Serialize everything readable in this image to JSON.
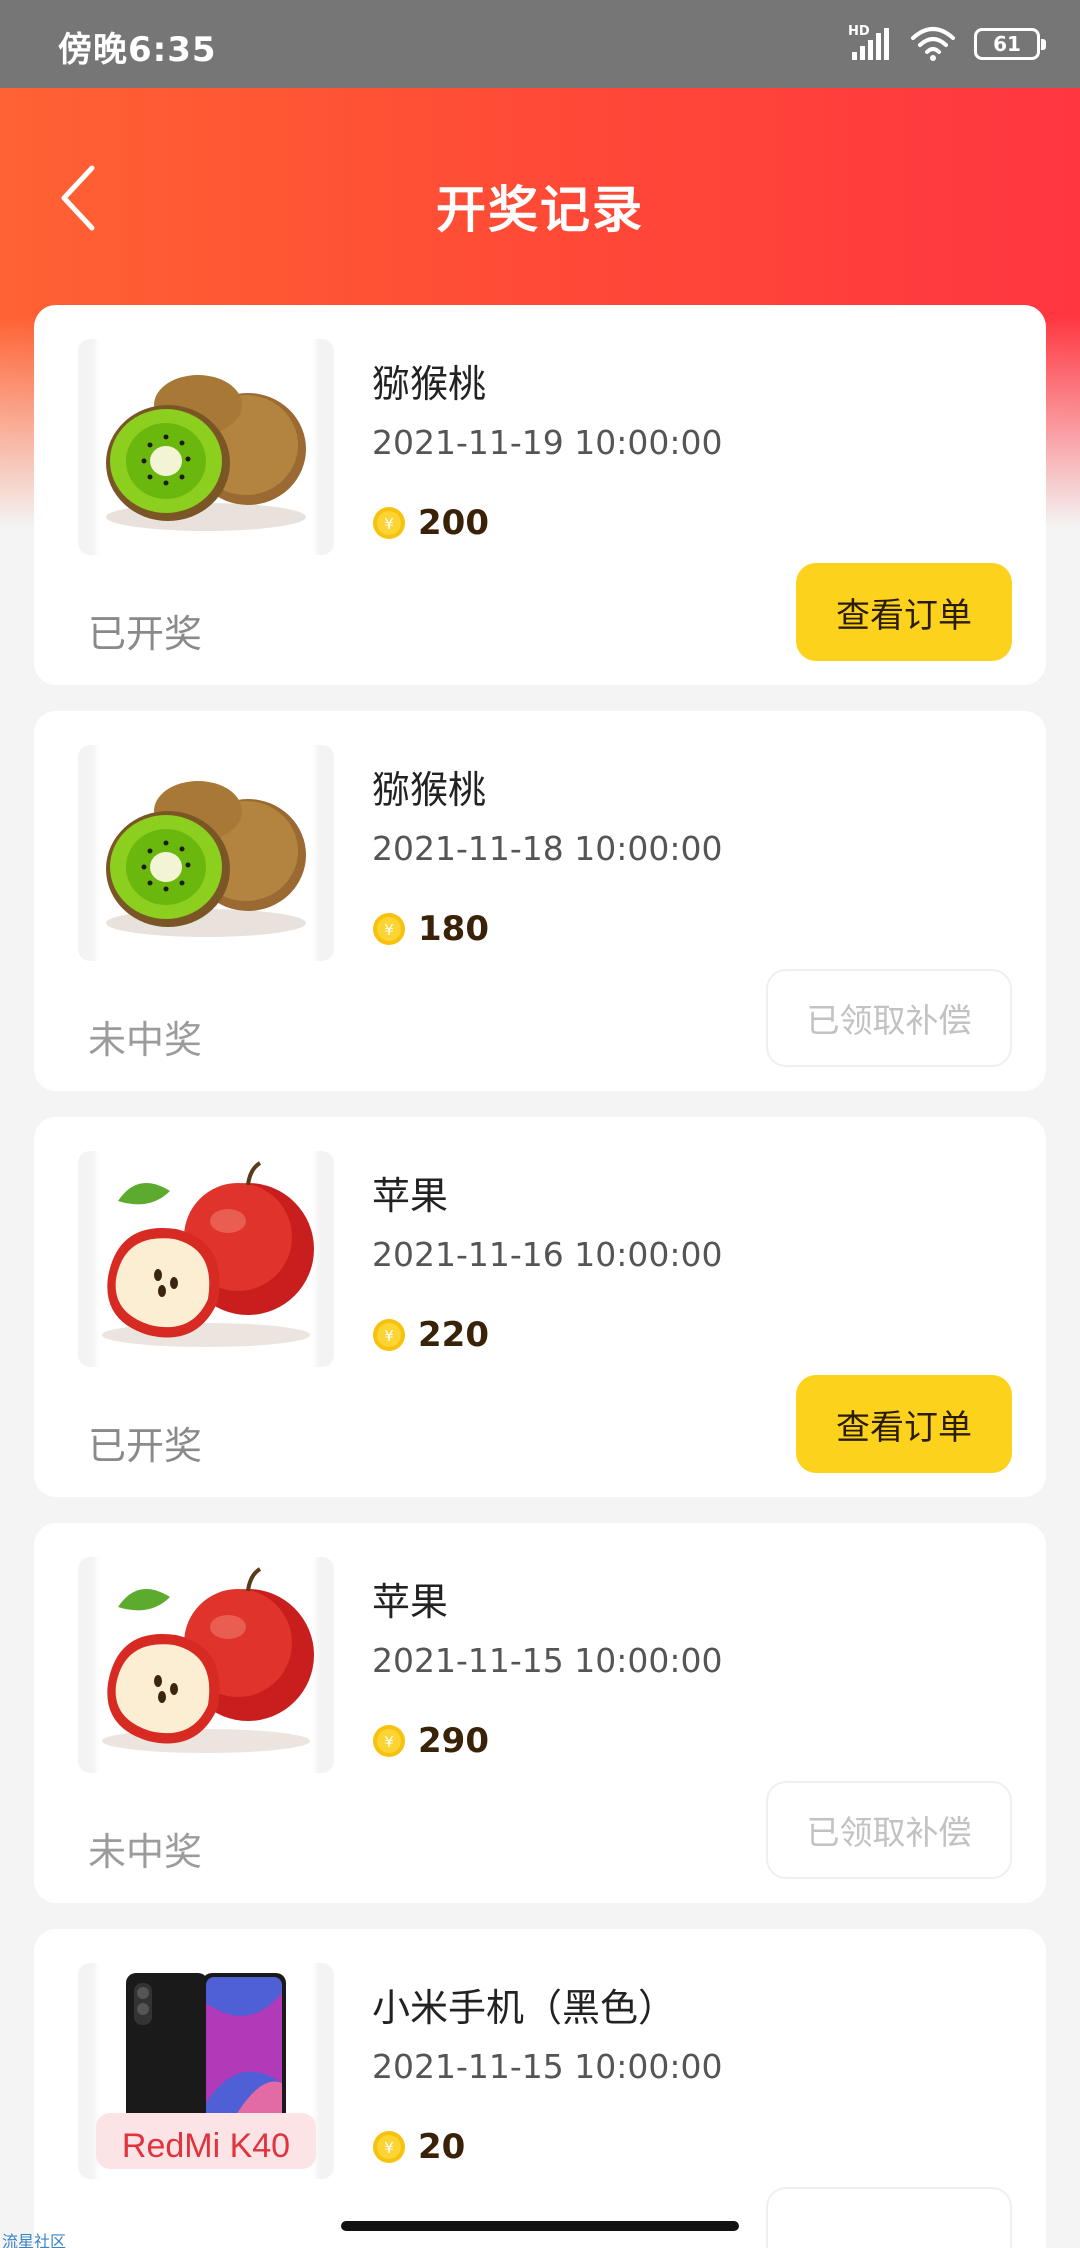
{
  "status_bar": {
    "time": "傍晚6:35",
    "network_label": "HD",
    "battery": "61"
  },
  "nav": {
    "title": "开奖记录",
    "back_icon": "chevron-left-icon"
  },
  "records": [
    {
      "name": "猕猴桃",
      "date": "2021-11-19 10:00:00",
      "price": "200",
      "status": "已开奖",
      "action": "查看订单",
      "image": "kiwi-image"
    },
    {
      "name": "猕猴桃",
      "date": "2021-11-18 10:00:00",
      "price": "180",
      "status": "未中奖",
      "action": "已领取补偿",
      "image": "kiwi-image"
    },
    {
      "name": "苹果",
      "date": "2021-11-16 10:00:00",
      "price": "220",
      "status": "已开奖",
      "action": "查看订单",
      "image": "apple-image"
    },
    {
      "name": "苹果",
      "date": "2021-11-15 10:00:00",
      "price": "290",
      "status": "未中奖",
      "action": "已领取补偿",
      "image": "apple-image"
    },
    {
      "name": "小米手机（黑色）",
      "date": "2021-11-15 10:00:00",
      "price": "20",
      "status": "",
      "action": "",
      "image": "phone-image",
      "image_caption": "RedMi K40"
    }
  ],
  "coin_symbol": "¥",
  "watermark": "流星社区",
  "colors": {
    "accent": "#ff4a36",
    "button": "#fcd21d",
    "price": "#3a2208"
  }
}
